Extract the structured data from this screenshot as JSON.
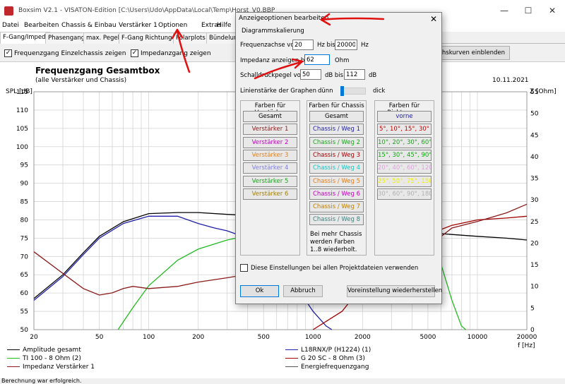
{
  "window": {
    "title": "Boxsim V2.1 - VISATON-Edition [C:\\Users\\Udo\\AppData\\Local\\Temp\\Horst_V0.BBP",
    "minimize": "—",
    "maximize": "☐",
    "close": "✕"
  },
  "menu": [
    "Datei",
    "Bearbeiten",
    "Chassis & Einbau",
    "Verstärker 1",
    "Optionen",
    "Extras",
    "Hilfe"
  ],
  "tabs": [
    {
      "label": "F-Gang/Imped.",
      "active": true
    },
    {
      "label": "Phasengang"
    },
    {
      "label": "max. Pegel"
    },
    {
      "label": "F-Gang Richtungen"
    },
    {
      "label": "Polarplots"
    },
    {
      "label": "Bündelung"
    }
  ],
  "options": {
    "freq_single": {
      "label": "Frequenzgang Einzelchassis zeigen",
      "checked": true
    },
    "impedance": {
      "label": "Impedanzgang zeigen",
      "checked": true
    },
    "load_curves": "eichskurven einblenden"
  },
  "chart_data": {
    "type": "line",
    "title": "Frequenzgang Gesamtbox",
    "subtitle": "(alle Verstärker und Chassis)",
    "date": "10.11.2021",
    "ylabel_left": "SPL [dB]",
    "ylabel_right": "Z [Ohm]",
    "xlabel": "f [Hz]",
    "x_scale": "log",
    "xlim": [
      20,
      20000
    ],
    "ylim_left": [
      50,
      115
    ],
    "ylim_right": [
      0,
      55
    ],
    "x_ticks": [
      20,
      50,
      100,
      200,
      500,
      1000,
      2000,
      5000,
      10000,
      20000
    ],
    "y_ticks_left": [
      50,
      55,
      60,
      65,
      70,
      75,
      80,
      85,
      90,
      95,
      100,
      105,
      110,
      115
    ],
    "y_ticks_right": [
      0,
      5,
      10,
      15,
      20,
      25,
      30,
      35,
      40,
      45,
      50,
      55
    ],
    "series": [
      {
        "name": "Amplitude gesamt",
        "color": "#000000",
        "axis": "left",
        "points": [
          [
            20,
            58.5
          ],
          [
            30,
            65
          ],
          [
            40,
            71
          ],
          [
            50,
            75.5
          ],
          [
            70,
            79.5
          ],
          [
            100,
            81.7
          ],
          [
            150,
            82
          ],
          [
            200,
            82
          ],
          [
            300,
            81.5
          ],
          [
            500,
            81
          ],
          [
            1000,
            79.6
          ],
          [
            2000,
            78
          ],
          [
            3000,
            77
          ],
          [
            5000,
            76.5
          ],
          [
            7000,
            76
          ],
          [
            10000,
            75.5
          ],
          [
            15000,
            75
          ],
          [
            20000,
            74.5
          ]
        ]
      },
      {
        "name": "L18RNX/P (H1224) (1)",
        "color": "#1f1fa8",
        "axis": "left",
        "points": [
          [
            20,
            58
          ],
          [
            30,
            64.5
          ],
          [
            40,
            70.5
          ],
          [
            50,
            75
          ],
          [
            70,
            79
          ],
          [
            100,
            81
          ],
          [
            150,
            81
          ],
          [
            200,
            79
          ],
          [
            250,
            77.8
          ],
          [
            300,
            77
          ],
          [
            400,
            75
          ],
          [
            500,
            73
          ],
          [
            700,
            66
          ],
          [
            900,
            58
          ],
          [
            1000,
            55
          ],
          [
            1200,
            51
          ],
          [
            1300,
            50
          ]
        ]
      },
      {
        "name": "TI 100 - 8 Ohm (2)",
        "color": "#22bb22",
        "axis": "left",
        "points": [
          [
            65,
            50
          ],
          [
            80,
            56
          ],
          [
            100,
            62
          ],
          [
            150,
            69
          ],
          [
            200,
            72
          ],
          [
            300,
            74.5
          ],
          [
            500,
            76.5
          ],
          [
            700,
            77
          ],
          [
            1000,
            78.5
          ],
          [
            1500,
            79.5
          ],
          [
            2000,
            80
          ],
          [
            3000,
            79.5
          ],
          [
            5000,
            74
          ],
          [
            6000,
            68
          ],
          [
            7000,
            58
          ],
          [
            8000,
            51
          ],
          [
            8500,
            50
          ]
        ]
      },
      {
        "name": "G 20 SC - 8 Ohm (3)",
        "color": "#a00000",
        "axis": "left",
        "points": [
          [
            1000,
            50
          ],
          [
            1500,
            55
          ],
          [
            2000,
            62
          ],
          [
            3000,
            70
          ],
          [
            5000,
            76
          ],
          [
            7000,
            78.5
          ],
          [
            10000,
            80
          ],
          [
            15000,
            80.5
          ],
          [
            20000,
            81
          ]
        ]
      },
      {
        "name": "Impedanz Verstärker 1",
        "color": "#8b1a1a",
        "axis": "right",
        "points": [
          [
            20,
            18
          ],
          [
            30,
            13
          ],
          [
            40,
            9.5
          ],
          [
            50,
            8
          ],
          [
            60,
            8.5
          ],
          [
            70,
            9.5
          ],
          [
            80,
            10
          ],
          [
            100,
            9.5
          ],
          [
            150,
            10
          ],
          [
            200,
            11
          ],
          [
            300,
            12
          ],
          [
            400,
            12.8
          ],
          [
            500,
            13
          ],
          [
            700,
            13.5
          ],
          [
            1000,
            14
          ],
          [
            1500,
            14.5
          ],
          [
            2000,
            15
          ],
          [
            3000,
            16
          ],
          [
            4000,
            18
          ],
          [
            5000,
            20
          ],
          [
            6000,
            21.5
          ],
          [
            7000,
            23.5
          ],
          [
            10000,
            25
          ],
          [
            15000,
            27
          ],
          [
            20000,
            29
          ]
        ]
      },
      {
        "name": "Energiefrequenzgang",
        "color": "#555555",
        "axis": "left",
        "points": []
      }
    ]
  },
  "dialog": {
    "title": "Anzeigeoptionen bearbeiten",
    "close": "✕",
    "section": "Diagrammskalierung",
    "freq_axis_label": "Frequenzachse von",
    "freq_from": "20",
    "freq_unit_bis": "Hz bis",
    "freq_to": "20000",
    "freq_unit": "Hz",
    "impedance_label": "Impedanz anzeigen bis",
    "impedance_value": "62",
    "impedance_unit": "Ohm",
    "spl_label": "Schalldruckpegel von",
    "spl_from": "50",
    "spl_bis": "dB bis",
    "spl_to": "112",
    "spl_unit": "dB",
    "line_width_label": "Linienstärke der Graphen",
    "line_thin": "dünn",
    "line_thick": "dick",
    "amp_colors": {
      "header": "Farben für Verstärker",
      "items": [
        {
          "label": "Gesamt",
          "color": "#000000"
        },
        {
          "label": "Verstärker 1",
          "color": "#8b1a1a"
        },
        {
          "label": "Verstärker 2",
          "color": "#c000c0"
        },
        {
          "label": "Verstärker 3",
          "color": "#e08020"
        },
        {
          "label": "Verstärker 4",
          "color": "#8080e0"
        },
        {
          "label": "Verstärker 5",
          "color": "#20a020"
        },
        {
          "label": "Verstärker 6",
          "color": "#a08000"
        }
      ]
    },
    "chassis_colors": {
      "header": "Farben für Chassis",
      "items": [
        {
          "label": "Gesamt",
          "color": "#000000"
        },
        {
          "label": "Chassis / Weg 1",
          "color": "#1f1fa8"
        },
        {
          "label": "Chassis / Weg 2",
          "color": "#20a020"
        },
        {
          "label": "Chassis / Weg 3",
          "color": "#a00000"
        },
        {
          "label": "Chassis / Weg 4",
          "color": "#20c0c0"
        },
        {
          "label": "Chassis / Weg 5",
          "color": "#e08020"
        },
        {
          "label": "Chassis / Weg 6",
          "color": "#c000c0"
        },
        {
          "label": "Chassis / Weg 7",
          "color": "#c08000"
        },
        {
          "label": "Chassis / Weg 8",
          "color": "#408080"
        }
      ],
      "note": [
        "Bei mehr Chassis",
        "werden Farben",
        "1..8 wiederholt."
      ]
    },
    "direction_colors": {
      "header": "Farben für Richtungen",
      "items": [
        {
          "label": "vorne",
          "color": "#1f1fa8"
        },
        {
          "label": "5°, 10°, 15°, 30°",
          "color": "#c00000"
        },
        {
          "label": "10°, 20°, 30°, 60°",
          "color": "#20a020"
        },
        {
          "label": "15°, 30°, 45°, 90°",
          "color": "#00b000"
        },
        {
          "label": "20°, 40°, 60°, 120°",
          "color": "#e0a0e0"
        },
        {
          "label": "25°, 50°, 75°, 150°",
          "color": "#f0f000"
        },
        {
          "label": "30°, 60°, 90°, 180°",
          "color": "#b0b0b0"
        }
      ]
    },
    "apply_all_label": "Diese Einstellungen bei allen Projektdateien verwenden",
    "apply_all_checked": false,
    "ok": "Ok",
    "cancel": "Abbruch",
    "reset": "Voreinstellung wiederherstellen"
  },
  "statusbar": "Berechnung war erfolgreich."
}
